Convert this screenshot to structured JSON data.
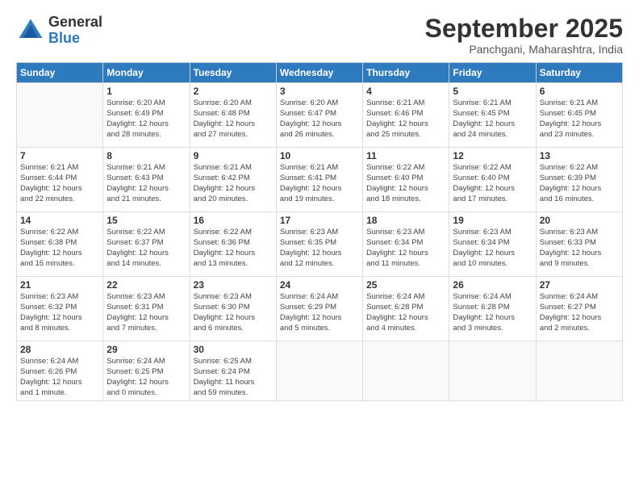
{
  "logo": {
    "general": "General",
    "blue": "Blue"
  },
  "title": "September 2025",
  "location": "Panchgani, Maharashtra, India",
  "weekdays": [
    "Sunday",
    "Monday",
    "Tuesday",
    "Wednesday",
    "Thursday",
    "Friday",
    "Saturday"
  ],
  "weeks": [
    [
      {
        "day": "",
        "info": ""
      },
      {
        "day": "1",
        "info": "Sunrise: 6:20 AM\nSunset: 6:49 PM\nDaylight: 12 hours\nand 28 minutes."
      },
      {
        "day": "2",
        "info": "Sunrise: 6:20 AM\nSunset: 6:48 PM\nDaylight: 12 hours\nand 27 minutes."
      },
      {
        "day": "3",
        "info": "Sunrise: 6:20 AM\nSunset: 6:47 PM\nDaylight: 12 hours\nand 26 minutes."
      },
      {
        "day": "4",
        "info": "Sunrise: 6:21 AM\nSunset: 6:46 PM\nDaylight: 12 hours\nand 25 minutes."
      },
      {
        "day": "5",
        "info": "Sunrise: 6:21 AM\nSunset: 6:45 PM\nDaylight: 12 hours\nand 24 minutes."
      },
      {
        "day": "6",
        "info": "Sunrise: 6:21 AM\nSunset: 6:45 PM\nDaylight: 12 hours\nand 23 minutes."
      }
    ],
    [
      {
        "day": "7",
        "info": "Sunrise: 6:21 AM\nSunset: 6:44 PM\nDaylight: 12 hours\nand 22 minutes."
      },
      {
        "day": "8",
        "info": "Sunrise: 6:21 AM\nSunset: 6:43 PM\nDaylight: 12 hours\nand 21 minutes."
      },
      {
        "day": "9",
        "info": "Sunrise: 6:21 AM\nSunset: 6:42 PM\nDaylight: 12 hours\nand 20 minutes."
      },
      {
        "day": "10",
        "info": "Sunrise: 6:21 AM\nSunset: 6:41 PM\nDaylight: 12 hours\nand 19 minutes."
      },
      {
        "day": "11",
        "info": "Sunrise: 6:22 AM\nSunset: 6:40 PM\nDaylight: 12 hours\nand 18 minutes."
      },
      {
        "day": "12",
        "info": "Sunrise: 6:22 AM\nSunset: 6:40 PM\nDaylight: 12 hours\nand 17 minutes."
      },
      {
        "day": "13",
        "info": "Sunrise: 6:22 AM\nSunset: 6:39 PM\nDaylight: 12 hours\nand 16 minutes."
      }
    ],
    [
      {
        "day": "14",
        "info": "Sunrise: 6:22 AM\nSunset: 6:38 PM\nDaylight: 12 hours\nand 15 minutes."
      },
      {
        "day": "15",
        "info": "Sunrise: 6:22 AM\nSunset: 6:37 PM\nDaylight: 12 hours\nand 14 minutes."
      },
      {
        "day": "16",
        "info": "Sunrise: 6:22 AM\nSunset: 6:36 PM\nDaylight: 12 hours\nand 13 minutes."
      },
      {
        "day": "17",
        "info": "Sunrise: 6:23 AM\nSunset: 6:35 PM\nDaylight: 12 hours\nand 12 minutes."
      },
      {
        "day": "18",
        "info": "Sunrise: 6:23 AM\nSunset: 6:34 PM\nDaylight: 12 hours\nand 11 minutes."
      },
      {
        "day": "19",
        "info": "Sunrise: 6:23 AM\nSunset: 6:34 PM\nDaylight: 12 hours\nand 10 minutes."
      },
      {
        "day": "20",
        "info": "Sunrise: 6:23 AM\nSunset: 6:33 PM\nDaylight: 12 hours\nand 9 minutes."
      }
    ],
    [
      {
        "day": "21",
        "info": "Sunrise: 6:23 AM\nSunset: 6:32 PM\nDaylight: 12 hours\nand 8 minutes."
      },
      {
        "day": "22",
        "info": "Sunrise: 6:23 AM\nSunset: 6:31 PM\nDaylight: 12 hours\nand 7 minutes."
      },
      {
        "day": "23",
        "info": "Sunrise: 6:23 AM\nSunset: 6:30 PM\nDaylight: 12 hours\nand 6 minutes."
      },
      {
        "day": "24",
        "info": "Sunrise: 6:24 AM\nSunset: 6:29 PM\nDaylight: 12 hours\nand 5 minutes."
      },
      {
        "day": "25",
        "info": "Sunrise: 6:24 AM\nSunset: 6:28 PM\nDaylight: 12 hours\nand 4 minutes."
      },
      {
        "day": "26",
        "info": "Sunrise: 6:24 AM\nSunset: 6:28 PM\nDaylight: 12 hours\nand 3 minutes."
      },
      {
        "day": "27",
        "info": "Sunrise: 6:24 AM\nSunset: 6:27 PM\nDaylight: 12 hours\nand 2 minutes."
      }
    ],
    [
      {
        "day": "28",
        "info": "Sunrise: 6:24 AM\nSunset: 6:26 PM\nDaylight: 12 hours\nand 1 minute."
      },
      {
        "day": "29",
        "info": "Sunrise: 6:24 AM\nSunset: 6:25 PM\nDaylight: 12 hours\nand 0 minutes."
      },
      {
        "day": "30",
        "info": "Sunrise: 6:25 AM\nSunset: 6:24 PM\nDaylight: 11 hours\nand 59 minutes."
      },
      {
        "day": "",
        "info": ""
      },
      {
        "day": "",
        "info": ""
      },
      {
        "day": "",
        "info": ""
      },
      {
        "day": "",
        "info": ""
      }
    ]
  ]
}
